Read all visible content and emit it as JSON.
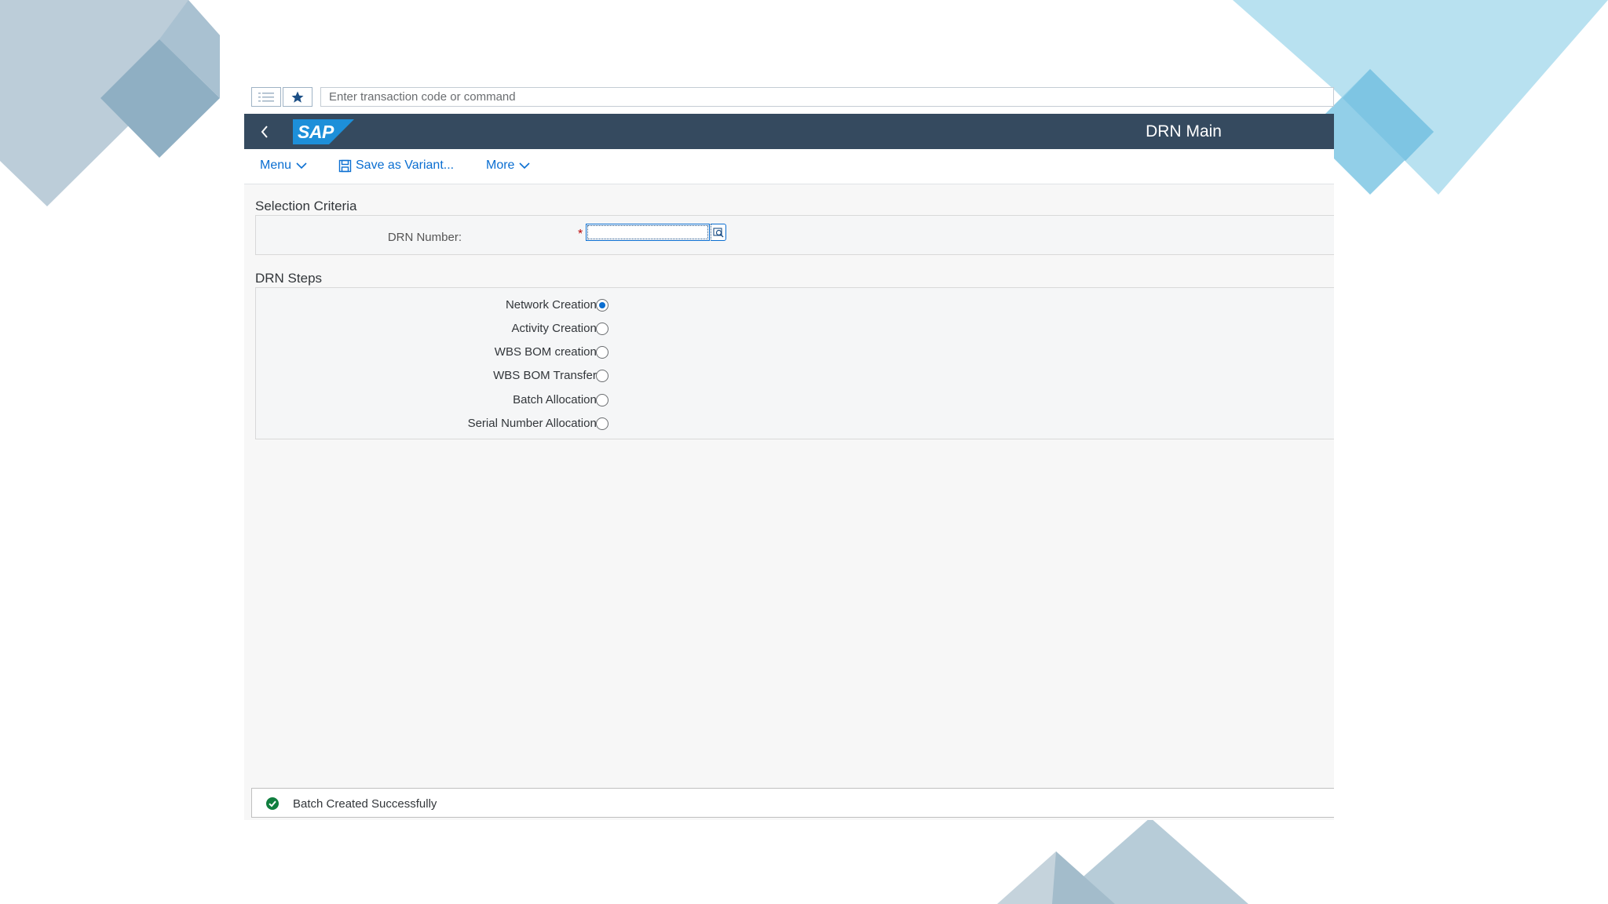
{
  "command_bar": {
    "placeholder": "Enter transaction code or command"
  },
  "shell": {
    "logo_text": "SAP",
    "title": "DRN Main"
  },
  "toolbar": {
    "menu_label": "Menu",
    "save_variant_label": "Save as Variant...",
    "more_label": "More"
  },
  "selection_criteria": {
    "title": "Selection Criteria",
    "drn_number_label": "DRN Number:",
    "required_marker": "*",
    "drn_number_value": ""
  },
  "drn_steps": {
    "title": "DRN Steps",
    "options": [
      {
        "label": "Network Creation:",
        "selected": true
      },
      {
        "label": "Activity Creation:",
        "selected": false
      },
      {
        "label": "WBS BOM creation:",
        "selected": false
      },
      {
        "label": "WBS BOM Transfer:",
        "selected": false
      },
      {
        "label": "Batch Allocation:",
        "selected": false
      },
      {
        "label": "Serial Number Allocation:",
        "selected": false
      }
    ]
  },
  "status": {
    "type": "success",
    "message": "Batch Created Successfully"
  },
  "colors": {
    "shell_bg": "#354a5f",
    "accent": "#0a6ed1",
    "success": "#107e3e",
    "required": "#bb0000"
  },
  "icons": [
    "list-icon",
    "star-icon",
    "back-chevron-icon",
    "chevron-down-icon",
    "save-icon",
    "value-help-icon",
    "success-check-icon"
  ]
}
